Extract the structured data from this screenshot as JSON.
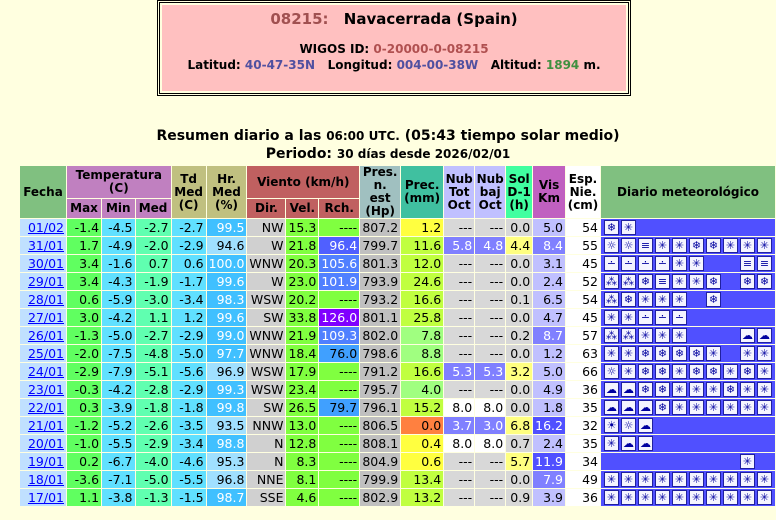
{
  "station": {
    "id": "08215:",
    "name": "Navacerrada (Spain)",
    "wigos_label": "WIGOS ID:",
    "wigos_id": "0-20000-0-08215",
    "lat_label": "Latitud:",
    "lat": "40-47-35N",
    "lon_label": "Longitud:",
    "lon": "004-00-38W",
    "alt_label": "Altitud:",
    "alt": "1894",
    "alt_unit": "m."
  },
  "summary": {
    "line1_a": "Resumen diario a las",
    "line1_b": "06:00 UTC.",
    "line1_c": "(05:43 tiempo solar medio)",
    "line2_a": "Periodo:",
    "line2_b": "30 días desde 2026/02/01"
  },
  "headers": {
    "fecha": "Fecha",
    "temp": "Temperatura (C)",
    "max": "Max",
    "min": "Min",
    "med": "Med",
    "td": "Td Med (C)",
    "hr": "Hr. Med (%)",
    "viento": "Viento (km/h)",
    "dir": "Dir.",
    "vel": "Vel.",
    "rch": "Rch.",
    "pres": "Pres. n. est (Hp)",
    "prec": "Prec. (mm)",
    "nubtot": "Nub Tot Oct",
    "nubbaj": "Nub baj Oct",
    "sol": "Sol D-1 (h)",
    "vis": "Vis Km",
    "esp": "Esp. Nie. (cm)",
    "diario": "Diario meteorológico"
  },
  "rows": [
    {
      "fecha": "01/02",
      "max": "-1.4",
      "min": "-4.5",
      "med": "-2.7",
      "td": "-2.7",
      "hr": "99.5",
      "dir": "NW",
      "vel": "15.3",
      "rch": "----",
      "pres": "807.2",
      "prec": "1.2",
      "nt": "---",
      "nb": "---",
      "sol": "0.0",
      "vis": "5.0",
      "esp": "54",
      "icons": [
        "snow-heavy-icon",
        "snow-icon"
      ]
    },
    {
      "fecha": "31/01",
      "max": "1.7",
      "min": "-4.9",
      "med": "-2.0",
      "td": "-2.9",
      "hr": "94.6",
      "dir": "W",
      "vel": "21.8",
      "rch": "96.4",
      "pres": "799.7",
      "prec": "11.6",
      "nt": "5.8",
      "nb": "4.8",
      "sol": "4.4",
      "vis": "8.4",
      "esp": "55",
      "icons": [
        "sun-snow-icon",
        "sun-snow-icon",
        "fog-icon",
        "snow-icon",
        "snow-icon",
        "snow-heavy-icon",
        "snow-heavy-icon",
        "snow-icon",
        "snow-icon",
        "snow-icon"
      ]
    },
    {
      "fecha": "30/01",
      "max": "3.4",
      "min": "-1.6",
      "med": "0.7",
      "td": "0.6",
      "hr": "100.0",
      "dir": "WNW",
      "vel": "20.3",
      "rch": "105.6",
      "pres": "801.3",
      "prec": "12.0",
      "nt": "---",
      "nb": "---",
      "sol": "0.0",
      "vis": "3.1",
      "esp": "45",
      "icons": [
        "rain-icon",
        "rain-icon",
        "rain-icon",
        "rain-icon",
        "snow-icon",
        "snow-icon",
        "blank",
        "blank",
        "fog-icon",
        "fog-icon"
      ]
    },
    {
      "fecha": "29/01",
      "max": "3.4",
      "min": "-4.3",
      "med": "-1.9",
      "td": "-1.7",
      "hr": "99.6",
      "dir": "W",
      "vel": "23.0",
      "rch": "101.9",
      "pres": "793.9",
      "prec": "24.6",
      "nt": "---",
      "nb": "---",
      "sol": "0.0",
      "vis": "2.4",
      "esp": "52",
      "icons": [
        "rain-snow-icon",
        "rain-snow-icon",
        "snow-heavy-icon",
        "fog-icon",
        "snow-icon",
        "snow-icon",
        "snow-heavy-icon",
        "blank",
        "snow-heavy-icon",
        "snow-heavy-icon"
      ]
    },
    {
      "fecha": "28/01",
      "max": "0.6",
      "min": "-5.9",
      "med": "-3.0",
      "td": "-3.4",
      "hr": "98.3",
      "dir": "WSW",
      "vel": "20.2",
      "rch": "----",
      "pres": "793.2",
      "prec": "16.6",
      "nt": "---",
      "nb": "---",
      "sol": "0.1",
      "vis": "6.5",
      "esp": "54",
      "icons": [
        "rain-snow-icon",
        "snow-heavy-icon",
        "snow-icon",
        "snow-icon",
        "snow-icon",
        "blank",
        "snow-heavy-icon",
        "blank",
        "blank",
        "blank"
      ]
    },
    {
      "fecha": "27/01",
      "max": "3.0",
      "min": "-4.2",
      "med": "1.1",
      "td": "1.2",
      "hr": "99.6",
      "dir": "SW",
      "vel": "33.8",
      "rch": "126.0",
      "pres": "801.1",
      "prec": "25.8",
      "nt": "---",
      "nb": "---",
      "sol": "0.0",
      "vis": "4.7",
      "esp": "45",
      "icons": [
        "snow-icon",
        "snow-icon",
        "rain-icon",
        "rain-icon",
        "rain-icon",
        "blank",
        "blank",
        "blank",
        "blank",
        "blank"
      ]
    },
    {
      "fecha": "26/01",
      "max": "-1.3",
      "min": "-5.0",
      "med": "-2.7",
      "td": "-2.9",
      "hr": "99.0",
      "dir": "WNW",
      "vel": "21.9",
      "rch": "109.3",
      "pres": "802.0",
      "prec": "7.8",
      "nt": "---",
      "nb": "---",
      "sol": "0.2",
      "vis": "8.7",
      "esp": "57",
      "icons": [
        "rain-snow-icon",
        "rain-snow-icon",
        "snow-icon",
        "snow-icon",
        "snow-icon",
        "blank",
        "blank",
        "blank",
        "cloud-icon",
        "cloud-icon"
      ]
    },
    {
      "fecha": "25/01",
      "max": "-2.0",
      "min": "-7.5",
      "med": "-4.8",
      "td": "-5.0",
      "hr": "97.7",
      "dir": "WNW",
      "vel": "18.4",
      "rch": "76.0",
      "pres": "798.6",
      "prec": "8.8",
      "nt": "---",
      "nb": "---",
      "sol": "0.0",
      "vis": "1.2",
      "esp": "63",
      "icons": [
        "snow-icon",
        "snow-icon",
        "snow-heavy-icon",
        "snow-heavy-icon",
        "snow-heavy-icon",
        "snow-heavy-icon",
        "snow-icon",
        "blank",
        "snow-icon",
        "snow-icon"
      ]
    },
    {
      "fecha": "24/01",
      "max": "-2.9",
      "min": "-7.9",
      "med": "-5.1",
      "td": "-5.6",
      "hr": "96.9",
      "dir": "WSW",
      "vel": "17.9",
      "rch": "----",
      "pres": "791.2",
      "prec": "16.6",
      "nt": "5.3",
      "nb": "5.3",
      "sol": "3.2",
      "vis": "5.0",
      "esp": "66",
      "icons": [
        "sun-snow-icon",
        "snow-icon",
        "snow-heavy-icon",
        "snow-heavy-icon",
        "snow-icon",
        "snow-heavy-icon",
        "snow-heavy-icon",
        "snow-icon",
        "snow-heavy-icon",
        "snow-icon"
      ]
    },
    {
      "fecha": "23/01",
      "max": "-0.3",
      "min": "-4.2",
      "med": "-2.8",
      "td": "-2.9",
      "hr": "99.3",
      "dir": "WSW",
      "vel": "23.4",
      "rch": "----",
      "pres": "795.7",
      "prec": "4.0",
      "nt": "---",
      "nb": "---",
      "sol": "0.0",
      "vis": "4.9",
      "esp": "36",
      "icons": [
        "cloud-icon",
        "cloud-icon",
        "snow-heavy-icon",
        "snow-heavy-icon",
        "snow-icon",
        "snow-icon",
        "snow-icon",
        "snow-heavy-icon",
        "snow-icon",
        "snow-icon"
      ]
    },
    {
      "fecha": "22/01",
      "max": "0.3",
      "min": "-3.9",
      "med": "-1.8",
      "td": "-1.8",
      "hr": "99.8",
      "dir": "SW",
      "vel": "26.5",
      "rch": "79.7",
      "pres": "796.1",
      "prec": "15.2",
      "nt": "8.0",
      "nb": "8.0",
      "sol": "0.0",
      "vis": "1.8",
      "esp": "35",
      "icons": [
        "cloud-icon",
        "cloud-icon",
        "cloud-icon",
        "snow-heavy-icon",
        "snow-icon",
        "snow-icon",
        "snow-icon",
        "snow-icon",
        "snow-icon",
        "snow-icon"
      ]
    },
    {
      "fecha": "21/01",
      "max": "-1.2",
      "min": "-5.2",
      "med": "-2.6",
      "td": "-3.5",
      "hr": "93.5",
      "dir": "NNW",
      "vel": "13.0",
      "rch": "----",
      "pres": "806.5",
      "prec": "0.0",
      "nt": "3.7",
      "nb": "3.0",
      "sol": "6.8",
      "vis": "16.2",
      "esp": "32",
      "icons": [
        "sun-icon",
        "sun-snow-icon",
        "cloud-icon",
        "blank",
        "blank",
        "blank",
        "blank",
        "blank",
        "blank",
        "blank"
      ]
    },
    {
      "fecha": "20/01",
      "max": "-1.0",
      "min": "-5.5",
      "med": "-2.9",
      "td": "-3.4",
      "hr": "98.8",
      "dir": "N",
      "vel": "12.8",
      "rch": "----",
      "pres": "808.1",
      "prec": "0.4",
      "nt": "8.0",
      "nb": "8.0",
      "sol": "0.7",
      "vis": "2.4",
      "esp": "35",
      "icons": [
        "snow-icon",
        "cloud-icon",
        "cloud-icon",
        "blank",
        "blank",
        "blank",
        "blank",
        "blank",
        "blank",
        "blank"
      ]
    },
    {
      "fecha": "19/01",
      "max": "0.2",
      "min": "-6.7",
      "med": "-4.0",
      "td": "-4.6",
      "hr": "95.3",
      "dir": "N",
      "vel": "8.3",
      "rch": "----",
      "pres": "804.9",
      "prec": "0.6",
      "nt": "---",
      "nb": "---",
      "sol": "5.7",
      "vis": "11.9",
      "esp": "34",
      "icons": [
        "blank",
        "blank",
        "blank",
        "blank",
        "blank",
        "blank",
        "blank",
        "blank",
        "snow-icon",
        "blank"
      ]
    },
    {
      "fecha": "18/01",
      "max": "-3.6",
      "min": "-7.1",
      "med": "-5.0",
      "td": "-5.5",
      "hr": "96.8",
      "dir": "NNE",
      "vel": "8.1",
      "rch": "----",
      "pres": "799.9",
      "prec": "13.4",
      "nt": "---",
      "nb": "---",
      "sol": "0.0",
      "vis": "7.9",
      "esp": "49",
      "icons": [
        "snow-icon",
        "snow-icon",
        "snow-icon",
        "snow-icon",
        "snow-icon",
        "snow-icon",
        "snow-icon",
        "snow-icon",
        "snow-icon",
        "snow-icon"
      ]
    },
    {
      "fecha": "17/01",
      "max": "1.1",
      "min": "-3.8",
      "med": "-1.3",
      "td": "-1.5",
      "hr": "98.7",
      "dir": "SSE",
      "vel": "4.6",
      "rch": "----",
      "pres": "802.9",
      "prec": "13.2",
      "nt": "---",
      "nb": "---",
      "sol": "0.9",
      "vis": "3.9",
      "esp": "36",
      "icons": [
        "snow-icon",
        "snow-icon",
        "snow-icon",
        "snow-icon",
        "snow-icon",
        "snow-icon",
        "snow-icon",
        "snow-icon",
        "snow-icon",
        "snow-icon"
      ]
    }
  ]
}
